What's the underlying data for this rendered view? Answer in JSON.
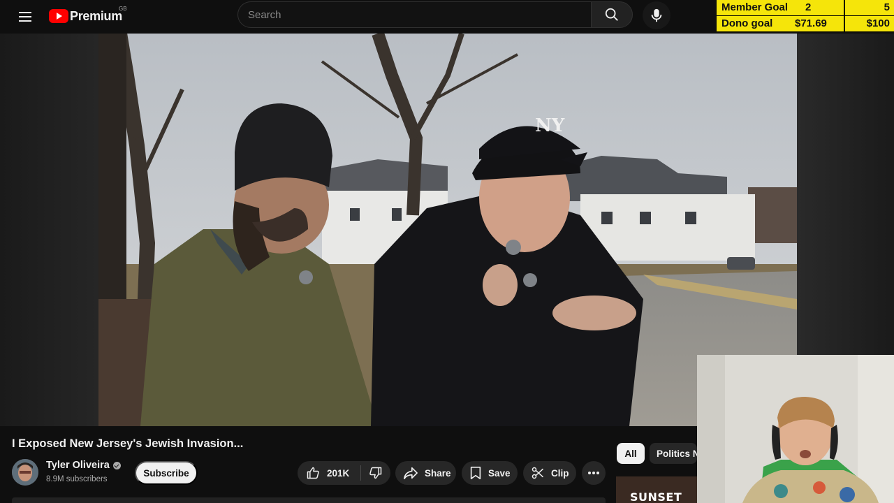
{
  "header": {
    "brand": "Premium",
    "country": "GB",
    "search_placeholder": "Search"
  },
  "goals": {
    "member": {
      "label": "Member Goal",
      "current": "2",
      "target": "5"
    },
    "dono": {
      "label": "Dono goal",
      "current": "$71.69",
      "target": "$100"
    }
  },
  "video": {
    "title": "I Exposed New Jersey's Jewish Invasion...",
    "channel": {
      "name": "Tyler Oliveira",
      "subscribers": "8.9M subscribers"
    },
    "subscribe_label": "Subscribe",
    "actions": {
      "likes": "201K",
      "share": "Share",
      "save": "Save",
      "clip": "Clip"
    }
  },
  "chips": [
    "All",
    "Politics N"
  ],
  "recommendation_peek": "SUNSET",
  "icons": [
    "menu-icon",
    "youtube-logo-icon",
    "search-icon",
    "mic-icon",
    "verified-icon",
    "thumbs-up-icon",
    "thumbs-down-icon",
    "share-icon",
    "bookmark-icon",
    "scissors-icon",
    "more-icon"
  ],
  "colors": {
    "goal_bar": "#f5e50a",
    "youtube_red": "#ff0000",
    "background": "#0f0f0f",
    "pill": "#272727"
  }
}
